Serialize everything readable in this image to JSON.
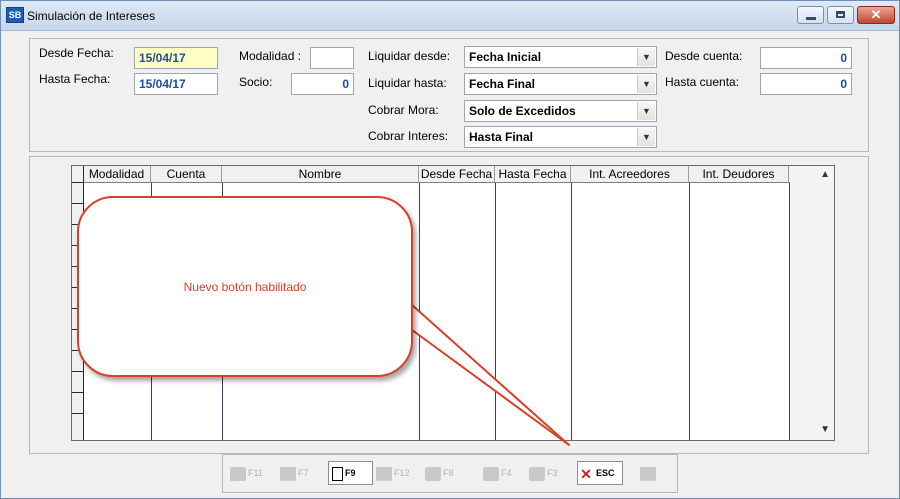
{
  "window": {
    "title": "Simulación de Intereses",
    "icon": "SB",
    "controls": [
      "minimize-icon",
      "maximize-icon",
      "close-icon"
    ]
  },
  "filters": {
    "desde_fecha": {
      "label": "Desde Fecha:",
      "value": "15/04/17"
    },
    "hasta_fecha": {
      "label": "Hasta Fecha:",
      "value": "15/04/17"
    },
    "modalidad": {
      "label": "Modalidad :",
      "value": ""
    },
    "socio": {
      "label": "Socio:",
      "value": "0"
    },
    "liquidar_desde": {
      "label": "Liquidar desde:",
      "value": "Fecha Inicial"
    },
    "liquidar_hasta": {
      "label": "Liquidar hasta:",
      "value": "Fecha Final"
    },
    "cobrar_mora": {
      "label": "Cobrar Mora:",
      "value": "Solo de Excedidos"
    },
    "cobrar_interes": {
      "label": "Cobrar Interes:",
      "value": "Hasta Final"
    },
    "desde_cuenta": {
      "label": "Desde cuenta:",
      "value": "0"
    },
    "hasta_cuenta": {
      "label": "Hasta cuenta:",
      "value": "0"
    }
  },
  "grid": {
    "columns": [
      "Modalidad",
      "Cuenta",
      "Nombre",
      "Desde Fecha",
      "Hasta Fecha",
      "Int. Acreedores",
      "Int. Deudores"
    ],
    "rows": []
  },
  "callout": {
    "text": "Nuevo botón habilitado"
  },
  "toolbar": {
    "buttons": [
      {
        "key": "F11",
        "enabled": false,
        "icon": "print-icon"
      },
      {
        "key": "F7",
        "enabled": false,
        "icon": "edit-icon"
      },
      {
        "key": "F9",
        "enabled": true,
        "icon": "new-document-icon"
      },
      {
        "key": "F12",
        "enabled": false,
        "icon": "edit-list-icon"
      },
      {
        "key": "F8",
        "enabled": false,
        "icon": "delete-icon"
      },
      {
        "key": "F4",
        "enabled": false,
        "icon": "undo-icon"
      },
      {
        "key": "F3",
        "enabled": false,
        "icon": "save-icon"
      },
      {
        "key": "ESC",
        "enabled": true,
        "icon": "exit-icon"
      },
      {
        "key": "",
        "enabled": false,
        "icon": "printer-icon"
      }
    ]
  },
  "colors": {
    "accent_text": "#1f4d9a",
    "date_field_bg": "#ffffc4",
    "callout_red": "#d8402a"
  }
}
